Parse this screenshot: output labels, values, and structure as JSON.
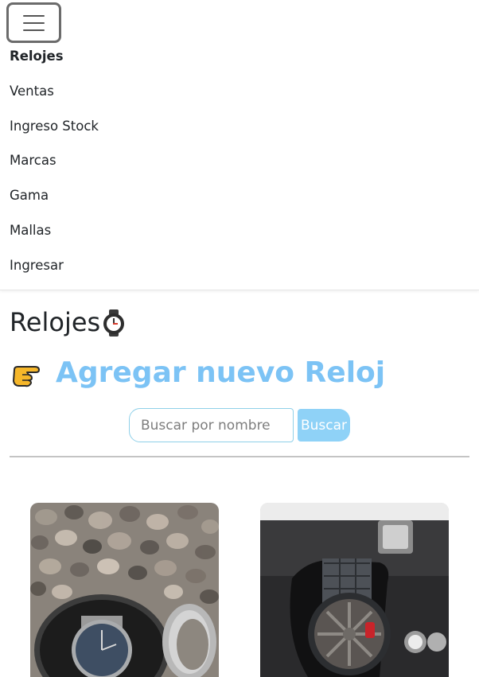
{
  "nav": {
    "toggle_icon": "hamburger-icon",
    "items": [
      {
        "label": "Relojes",
        "active": true
      },
      {
        "label": "Ventas",
        "active": false
      },
      {
        "label": "Ingreso Stock",
        "active": false
      },
      {
        "label": "Marcas",
        "active": false
      },
      {
        "label": "Gama",
        "active": false
      },
      {
        "label": "Mallas",
        "active": false
      },
      {
        "label": "Ingresar",
        "active": false
      }
    ]
  },
  "header": {
    "title": "Relojes",
    "title_icon": "watch-icon",
    "add_icon": "pointing-hand-icon",
    "add_label": "Agregar nuevo Reloj"
  },
  "search": {
    "placeholder": "Buscar por nombre",
    "value": "",
    "button_label": "Buscar"
  },
  "cards": [
    {
      "image": "watch-on-gravel-photo"
    },
    {
      "image": "watch-in-gloved-hand-photo"
    }
  ],
  "colors": {
    "accent": "#7cc3f5",
    "button": "#8fd2f7",
    "input_border": "#8fd0e9"
  }
}
